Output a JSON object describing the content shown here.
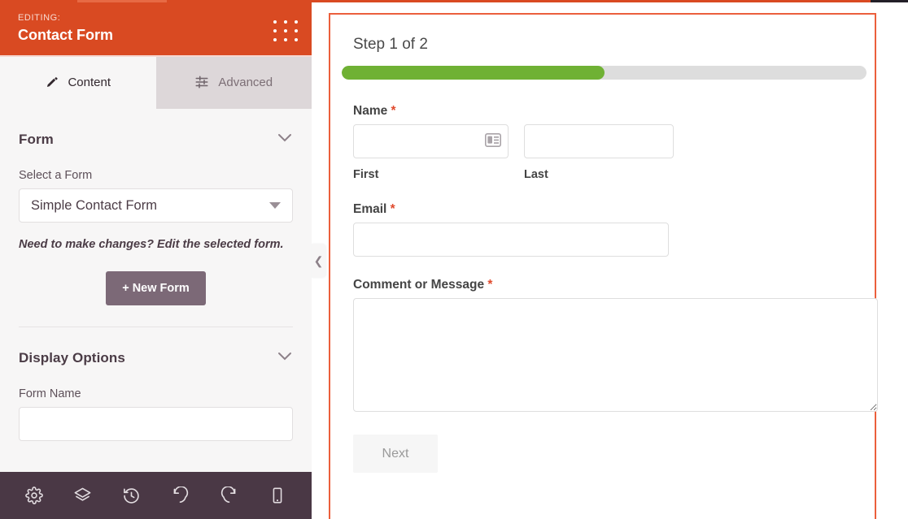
{
  "sidebar": {
    "header": {
      "editing_label": "EDITING:",
      "title": "Contact Form",
      "drag_handle_icon": "apps-grid-dots-icon",
      "background_color": "#d94a22"
    },
    "tabs": [
      {
        "label": "Content",
        "icon": "pencil-icon",
        "active": true
      },
      {
        "label": "Advanced",
        "icon": "sliders-icon",
        "active": false
      }
    ],
    "sections": [
      {
        "title": "Form",
        "collapse_icon": "chevron-down-icon",
        "select_label": "Select a Form",
        "select_value": "Simple Contact Form",
        "select_options": [
          "Simple Contact Form"
        ],
        "hint": "Need to make changes? Edit the selected form.",
        "button_label": "+ New Form",
        "button_color": "#7c6977"
      },
      {
        "title": "Display Options",
        "collapse_icon": "chevron-down-icon",
        "form_name_label": "Form Name",
        "form_name_value": "",
        "form_name_placeholder": ""
      }
    ],
    "collapse_handle_icon": "chevron-left-icon",
    "toolbar": {
      "background_color": "#4a3845",
      "items": [
        {
          "icon": "gear-icon",
          "name": "settings"
        },
        {
          "icon": "layers-icon",
          "name": "layers"
        },
        {
          "icon": "history-clock-icon",
          "name": "revisions"
        },
        {
          "icon": "undo-icon",
          "name": "undo"
        },
        {
          "icon": "redo-icon",
          "name": "redo"
        },
        {
          "icon": "mobile-device-icon",
          "name": "responsive-preview"
        }
      ]
    }
  },
  "preview": {
    "border_color": "#eb5f3c",
    "step_title": "Step 1 of 2",
    "progress": {
      "percent": 50,
      "fill_color": "#6fb134",
      "track_color": "#dddddd"
    },
    "fields": [
      {
        "label": "Name",
        "required": true,
        "required_marker": "*",
        "type": "name",
        "subfields": [
          {
            "sub_label": "First",
            "value": "",
            "placeholder": "",
            "icon": "contact-card-icon"
          },
          {
            "sub_label": "Last",
            "value": "",
            "placeholder": ""
          }
        ]
      },
      {
        "label": "Email",
        "required": true,
        "required_marker": "*",
        "type": "email",
        "value": "",
        "placeholder": ""
      },
      {
        "label": "Comment or Message",
        "required": true,
        "required_marker": "*",
        "type": "textarea",
        "value": "",
        "placeholder": ""
      }
    ],
    "submit": {
      "label": "Next",
      "disabled": true
    }
  }
}
